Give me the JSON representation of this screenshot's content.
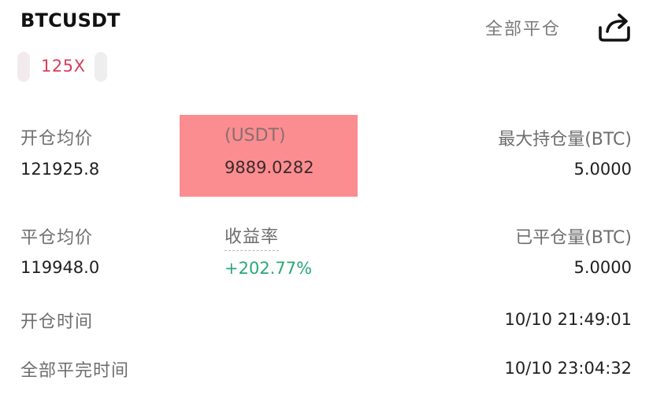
{
  "header": {
    "symbol": "BTCUSDT",
    "close_all": "全部平仓",
    "share_icon": "share-icon"
  },
  "leverage": "125X",
  "stats": {
    "avg_open_price": {
      "label": "开仓均价",
      "value": "121925.8"
    },
    "pnl": {
      "label": "(USDT)",
      "value": "9889.0282",
      "highlight_color": "#fb8d90"
    },
    "max_position": {
      "label": "最大持仓量(BTC)",
      "value": "5.0000"
    },
    "avg_close_price": {
      "label": "平仓均价",
      "value": "119948.0"
    },
    "roi": {
      "label": "收益率",
      "value": "+202.77%",
      "color": "#2aa876"
    },
    "closed_position": {
      "label": "已平仓量(BTC)",
      "value": "5.0000"
    },
    "open_time": {
      "label": "开仓时间",
      "value": "10/10 21:49:01"
    },
    "full_close_time": {
      "label": "全部平完时间",
      "value": "10/10 23:04:32"
    }
  }
}
